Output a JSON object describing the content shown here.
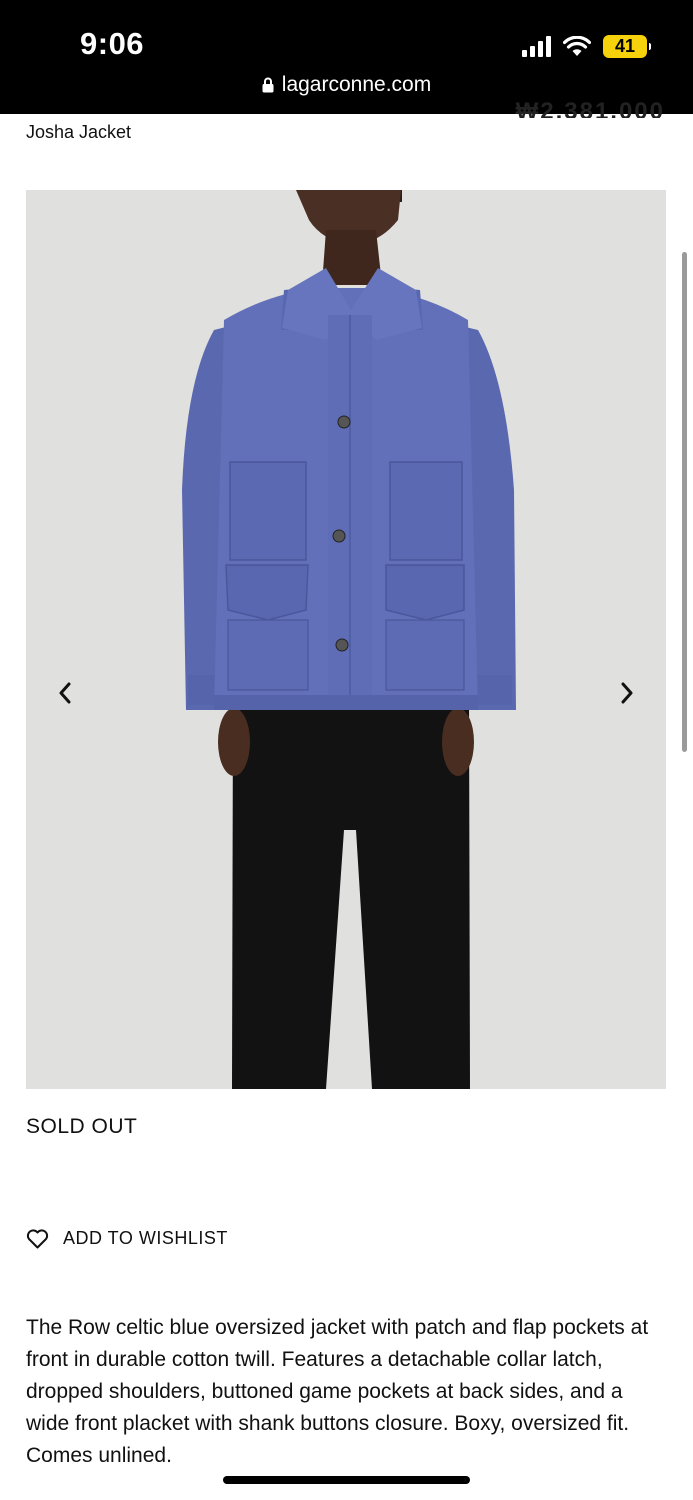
{
  "status_bar": {
    "time": "9:06",
    "battery": "41"
  },
  "browser": {
    "url": "lagarconne.com"
  },
  "product": {
    "title": "Josha Jacket",
    "price": "₩2,381,000",
    "availability": "SOLD OUT",
    "wishlist_label": "ADD TO WISHLIST",
    "description": "The Row celtic blue oversized jacket with patch and flap pockets at front in durable cotton twill. Features a detachable collar latch, dropped shoulders, buttoned game pockets at back sides, and a wide front placket with shank buttons closure. Boxy, oversized fit. Comes unlined."
  },
  "gallery": {
    "prev_icon": "chevron-left-icon",
    "next_icon": "chevron-right-icon"
  },
  "colors": {
    "jacket": "#5f6db5",
    "background": "#e3e3e1",
    "trousers": "#111111",
    "battery": "#f5d20b"
  }
}
